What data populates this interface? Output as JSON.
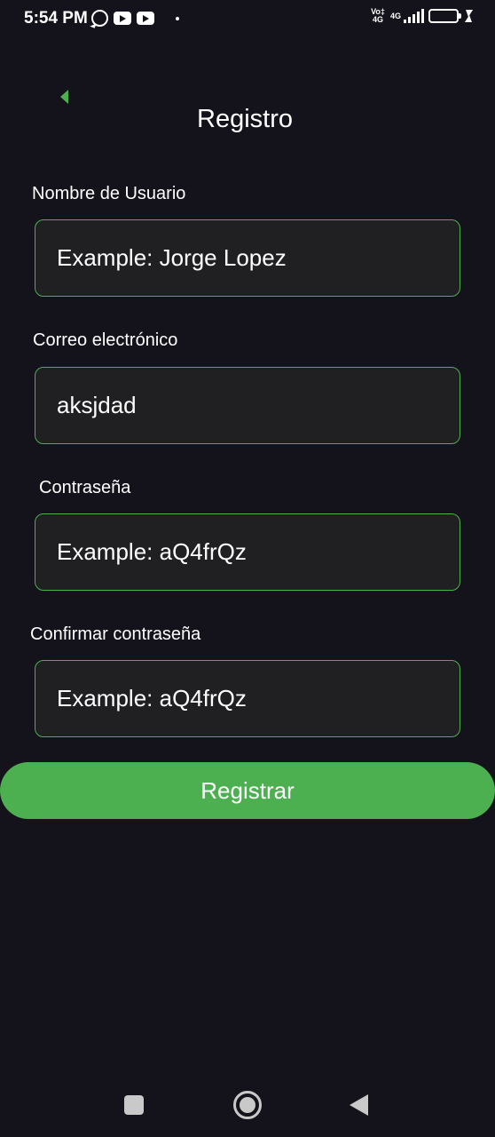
{
  "status_bar": {
    "time": "5:54 PM",
    "volte": "Vo‡\n4G",
    "network": "4G",
    "battery": "51"
  },
  "header": {
    "title": "Registro"
  },
  "form": {
    "username": {
      "label": "Nombre de Usuario",
      "placeholder": "Example: Jorge Lopez",
      "value": ""
    },
    "email": {
      "label": "Correo electrónico",
      "placeholder": "",
      "value": "aksjdad"
    },
    "password": {
      "label": "Contraseña",
      "placeholder": "Example: aQ4frQz",
      "value": ""
    },
    "confirm_password": {
      "label": "Confirmar contraseña",
      "placeholder": "Example: aQ4frQz",
      "value": ""
    },
    "submit_label": "Registrar"
  },
  "colors": {
    "accent": "#4caf50",
    "background": "#14121a",
    "field_bg": "#201f22"
  },
  "icons": {
    "back": "chevron-left-icon",
    "nav_recents": "square-icon",
    "nav_home": "circle-icon",
    "nav_back": "triangle-left-icon"
  }
}
